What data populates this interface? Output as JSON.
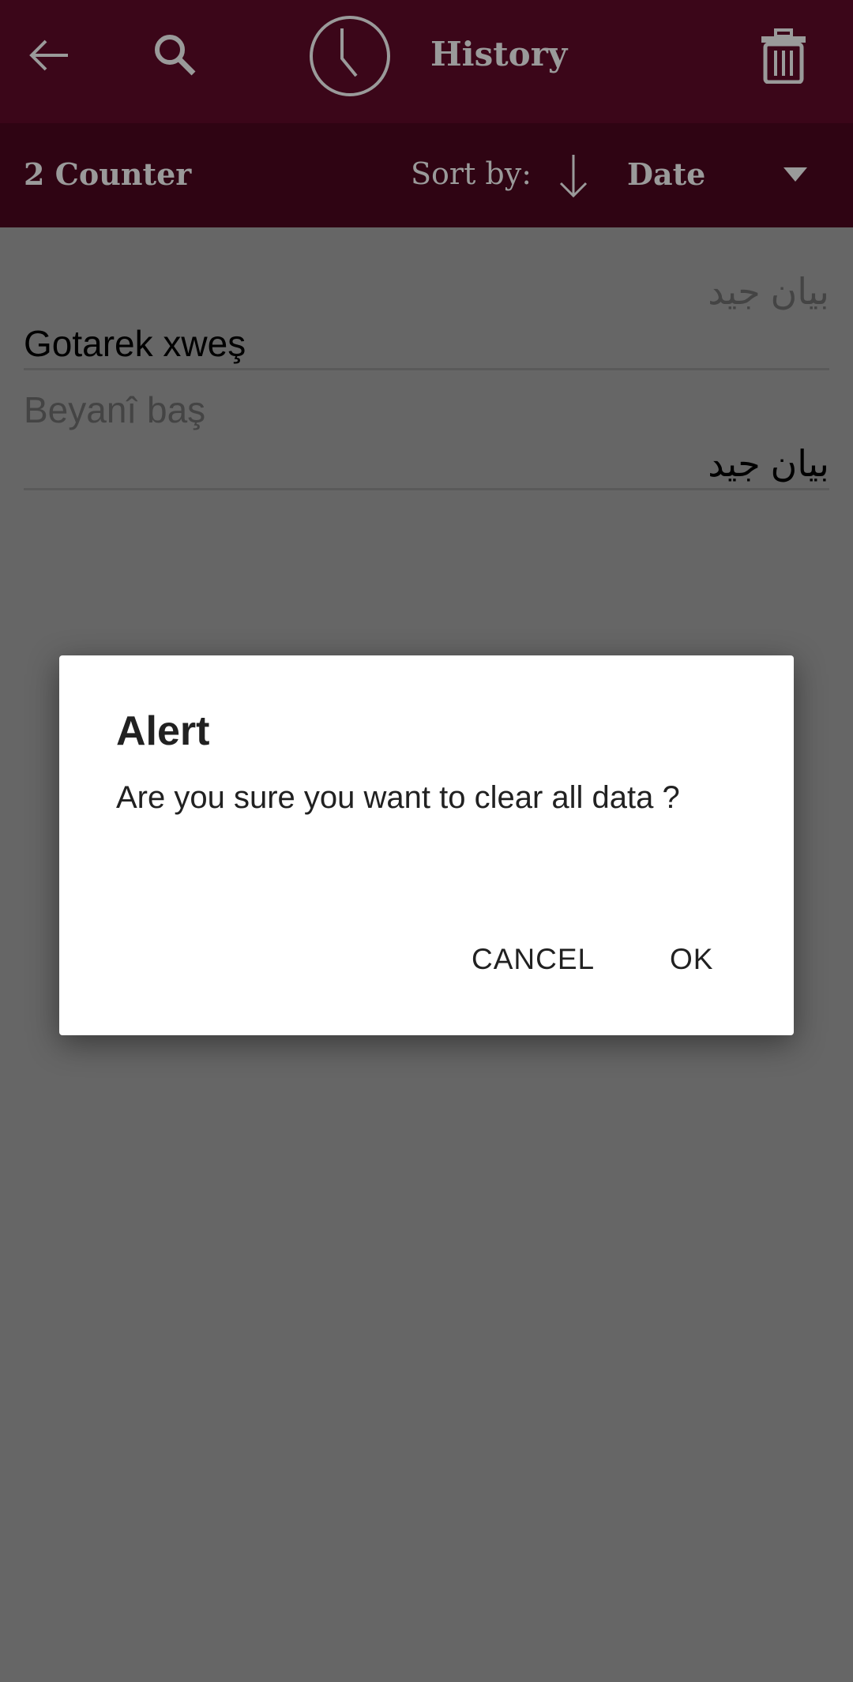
{
  "toolbar": {
    "title": "History",
    "icons": [
      "back-arrow-icon",
      "search-icon",
      "clock-icon",
      "trash-icon"
    ]
  },
  "subbar": {
    "counter": "2 Counter",
    "sort_label": "Sort by:",
    "sort_value": "Date",
    "sort_direction": "descending"
  },
  "list": [
    {
      "source": "بيان جيد",
      "translation": "Gotarek xweş"
    },
    {
      "source": "Beyanî baş",
      "translation": "بيان جيد"
    }
  ],
  "dialog": {
    "title": "Alert",
    "message": "Are you sure you want to clear all data ?",
    "cancel": "CANCEL",
    "ok": "OK"
  },
  "colors": {
    "toolbar": "#3b0619",
    "subbar": "#2f0413",
    "scrim_bg": "#666666"
  }
}
